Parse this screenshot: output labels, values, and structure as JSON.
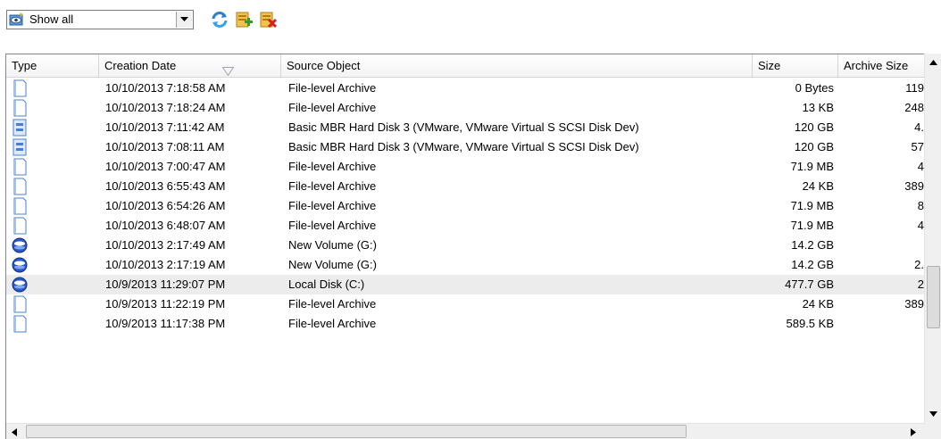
{
  "toolbar": {
    "filter_value": "Show all",
    "filter_icon": "eye-filter-icon",
    "buttons": [
      {
        "icon": "refresh-icon"
      },
      {
        "icon": "add-archive-icon"
      },
      {
        "icon": "delete-archive-icon"
      }
    ]
  },
  "table": {
    "columns": [
      "Type",
      "Creation Date",
      "Source Object",
      "Size",
      "Archive Size"
    ],
    "sorted_column": "Creation Date",
    "rows": [
      {
        "type_icon": "file-archive-icon",
        "date": "10/10/2013 7:18:58 AM",
        "source": "File-level Archive",
        "size": "0 Bytes",
        "archive_size": "119"
      },
      {
        "type_icon": "file-archive-icon",
        "date": "10/10/2013 7:18:24 AM",
        "source": "File-level Archive",
        "size": "13 KB",
        "archive_size": "248"
      },
      {
        "type_icon": "disk-archive-icon",
        "date": "10/10/2013 7:11:42 AM",
        "source": "Basic MBR Hard Disk 3 (VMware, VMware Virtual S SCSI Disk Dev)",
        "size": "120 GB",
        "archive_size": "4."
      },
      {
        "type_icon": "disk-archive-icon",
        "date": "10/10/2013 7:08:11 AM",
        "source": "Basic MBR Hard Disk 3 (VMware, VMware Virtual S SCSI Disk Dev)",
        "size": "120 GB",
        "archive_size": "57"
      },
      {
        "type_icon": "file-archive-icon",
        "date": "10/10/2013 7:00:47 AM",
        "source": "File-level Archive",
        "size": "71.9 MB",
        "archive_size": "4"
      },
      {
        "type_icon": "file-archive-icon",
        "date": "10/10/2013 6:55:43 AM",
        "source": "File-level Archive",
        "size": "24 KB",
        "archive_size": "389"
      },
      {
        "type_icon": "file-archive-icon",
        "date": "10/10/2013 6:54:26 AM",
        "source": "File-level Archive",
        "size": "71.9 MB",
        "archive_size": "8"
      },
      {
        "type_icon": "file-archive-icon",
        "date": "10/10/2013 6:48:07 AM",
        "source": "File-level Archive",
        "size": "71.9 MB",
        "archive_size": "4"
      },
      {
        "type_icon": "volume-archive-icon",
        "date": "10/10/2013 2:17:49 AM",
        "source": "New Volume (G:)",
        "size": "14.2 GB",
        "archive_size": ""
      },
      {
        "type_icon": "volume-archive-icon",
        "date": "10/10/2013 2:17:19 AM",
        "source": "New Volume (G:)",
        "size": "14.2 GB",
        "archive_size": "2."
      },
      {
        "type_icon": "volume-archive-icon",
        "date": "10/9/2013 11:29:07 PM",
        "source": "Local Disk (C:)",
        "size": "477.7 GB",
        "archive_size": "2",
        "selected": true
      },
      {
        "type_icon": "file-archive-icon",
        "date": "10/9/2013 11:22:19 PM",
        "source": "File-level Archive",
        "size": "24 KB",
        "archive_size": "389"
      },
      {
        "type_icon": "file-archive-icon",
        "date": "10/9/2013 11:17:38 PM",
        "source": "File-level Archive",
        "size": "589.5 KB",
        "archive_size": ""
      }
    ]
  }
}
